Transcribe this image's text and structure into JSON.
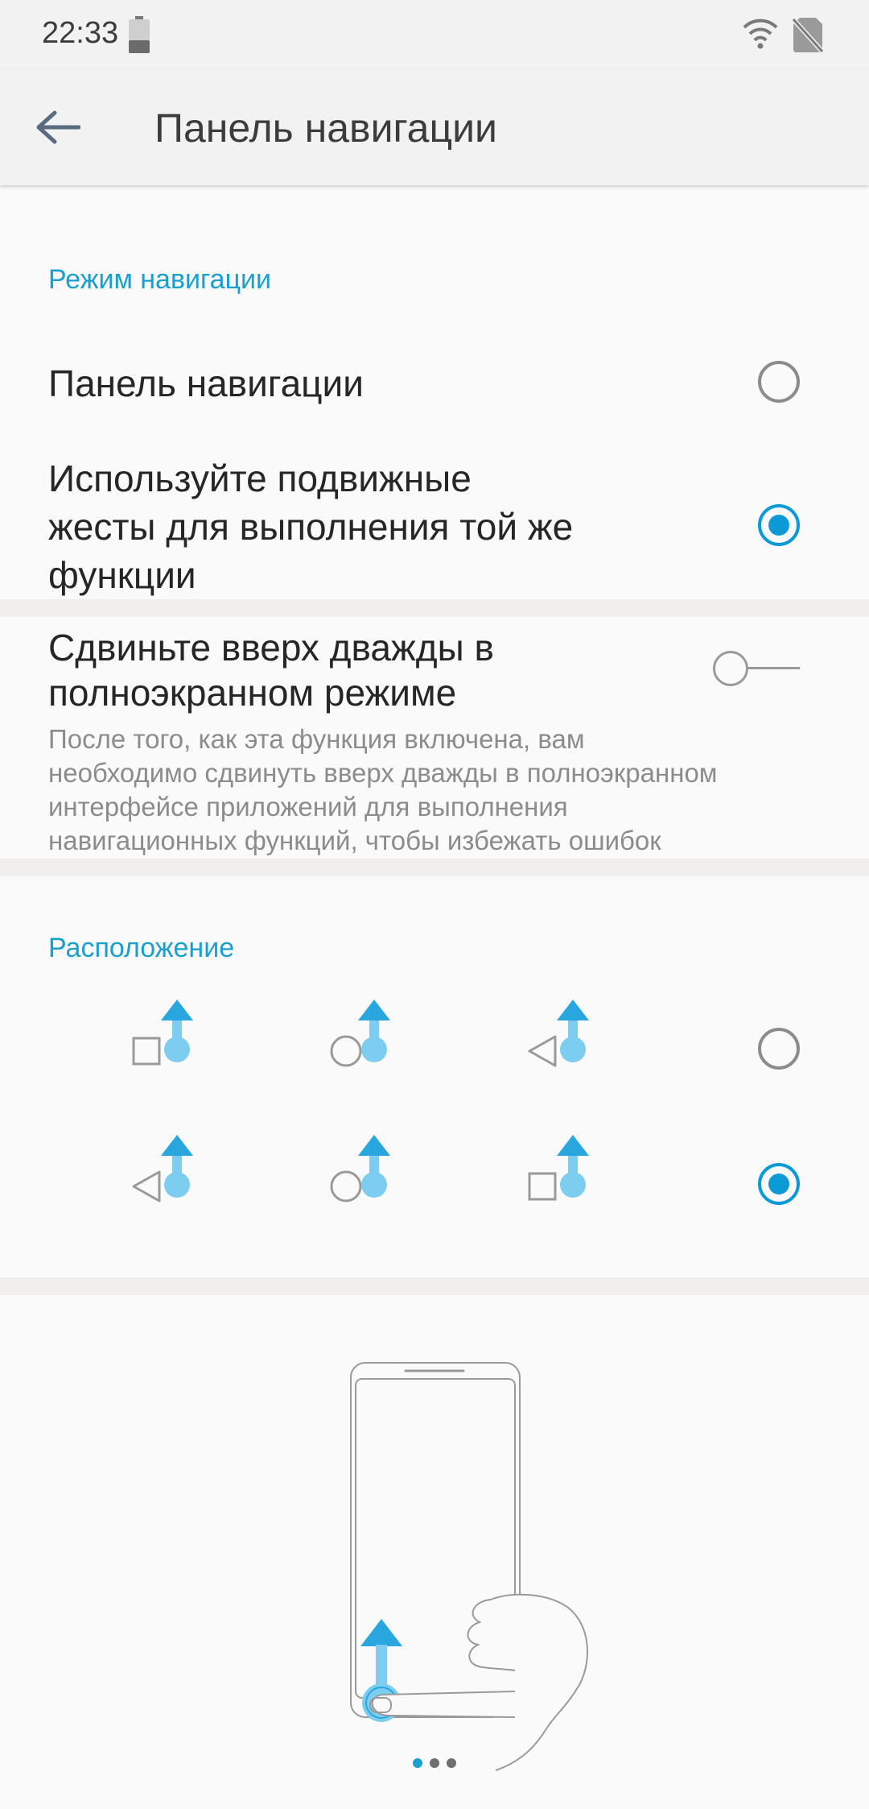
{
  "status_bar": {
    "time": "22:33",
    "icons": [
      "battery-icon",
      "wifi-icon",
      "no-sim-icon"
    ]
  },
  "app_bar": {
    "back_icon": "arrow-back-icon",
    "title": "Панель навигации"
  },
  "navigation_mode": {
    "section_label": "Режим навигации",
    "options": [
      {
        "label": "Панель навигации",
        "selected": false
      },
      {
        "label_lines": [
          "Используйте подвижные",
          "жесты для выполнения той же",
          "функции"
        ],
        "selected": true
      }
    ]
  },
  "swipe_twice": {
    "title_lines": [
      "Сдвиньте вверх дважды в",
      "полноэкранном режиме"
    ],
    "description_lines": [
      "После того, как эта функция включена, вам",
      "необходимо сдвинуть вверх дважды в полноэкранном",
      "интерфейсе приложений для выполнения",
      "навигационных функций, чтобы избежать ошибок"
    ],
    "enabled": false
  },
  "layout": {
    "section_label": "Расположение",
    "options": [
      {
        "icons": [
          "square-icon",
          "circle-icon",
          "triangle-back-icon"
        ],
        "selected": false
      },
      {
        "icons": [
          "triangle-back-icon",
          "circle-icon",
          "square-icon"
        ],
        "selected": true
      }
    ]
  },
  "illustration": {
    "icon": "phone-swipe-gesture-illustration",
    "page_indicator": {
      "count": 3,
      "active": 0
    }
  },
  "colors": {
    "accent": "#0c9ad6",
    "section_label": "#1a9fcf",
    "gesture_blue": "#7dcdf0"
  }
}
